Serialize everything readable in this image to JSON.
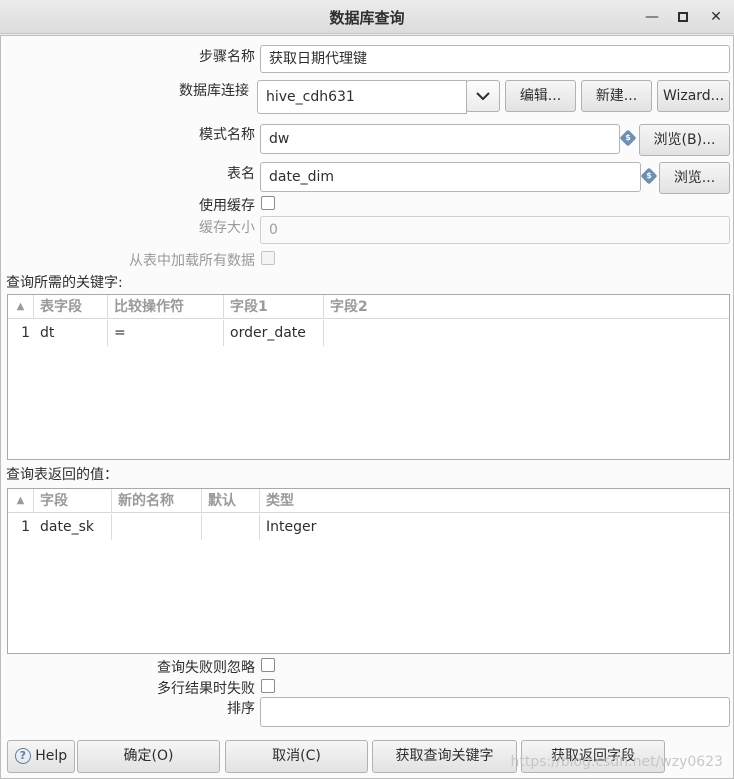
{
  "window": {
    "title": "数据库查询",
    "minimize": "—",
    "maximize": "□",
    "close": "✕"
  },
  "form": {
    "step_name_label": "步骤名称",
    "step_name_value": "获取日期代理键",
    "db_conn_label": "数据库连接",
    "db_conn_value": "hive_cdh631",
    "edit_button": "编辑...",
    "new_button": "新建...",
    "wizard_button": "Wizard...",
    "schema_label": "模式名称",
    "schema_value": "dw",
    "browse_b_button": "浏览(B)...",
    "table_label": "表名",
    "table_value": "date_dim",
    "browse_button": "浏览...",
    "use_cache_label": "使用缓存",
    "cache_size_label": "缓存大小",
    "cache_size_value": "0",
    "load_all_label": "从表中加载所有数据"
  },
  "keys_section": {
    "label": "查询所需的关键字:",
    "columns": [
      "表字段",
      "比较操作符",
      "字段1",
      "字段2"
    ],
    "rows": [
      {
        "num": "1",
        "table_field": "dt",
        "comparator": "=",
        "field1": "order_date",
        "field2": ""
      }
    ]
  },
  "return_section": {
    "label": "查询表返回的值：",
    "columns": [
      "字段",
      "新的名称",
      "默认",
      "类型"
    ],
    "rows": [
      {
        "num": "1",
        "field": "date_sk",
        "new_name": "",
        "default": "",
        "type": "Integer"
      }
    ]
  },
  "options": {
    "fail_ignore_label": "查询失败则忽略",
    "multi_fail_label": "多行结果时失败",
    "order_label": "排序",
    "order_value": ""
  },
  "buttons": {
    "help": "Help",
    "ok": "确定(O)",
    "cancel": "取消(C)",
    "get_keys": "获取查询关键字",
    "get_fields": "获取返回字段"
  },
  "watermark": "https://blog.csdn.net/wzy0623",
  "icons": {
    "sort": "▲",
    "chevron": "chevron-down-icon",
    "help": "?",
    "variable": "$"
  },
  "colors": {
    "background": "#fbfbfb",
    "titlebar": "#e4e4e4",
    "border": "#b5b5b5"
  }
}
